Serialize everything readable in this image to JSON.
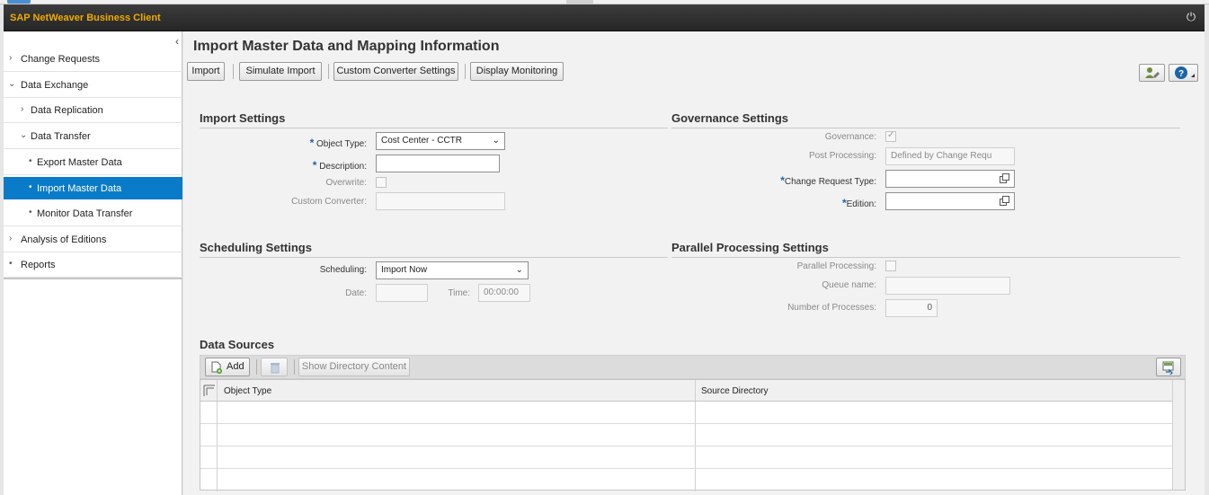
{
  "shell": {
    "title": "SAP NetWeaver Business Client"
  },
  "nav": {
    "items": [
      {
        "label": "Change Requests",
        "arrow": "›"
      },
      {
        "label": "Data Exchange",
        "arrow": "⌄"
      },
      {
        "label": "Data Replication",
        "arrow": "›"
      },
      {
        "label": "Data Transfer",
        "arrow": "⌄"
      },
      {
        "label": "Export Master Data",
        "arrow": "•"
      },
      {
        "label": "Import Master Data",
        "arrow": "•"
      },
      {
        "label": "Monitor Data Transfer",
        "arrow": "•"
      },
      {
        "label": "Analysis of Editions",
        "arrow": "›"
      },
      {
        "label": "Reports",
        "arrow": "•"
      }
    ]
  },
  "page": {
    "title": "Import Master Data and Mapping Information"
  },
  "toolbar": {
    "import": "Import",
    "simulate_import": "Simulate Import",
    "custom_converter_settings": "Custom Converter Settings",
    "display_monitoring": "Display Monitoring"
  },
  "import_settings": {
    "title": "Import Settings",
    "object_type_label": "Object Type:",
    "object_type_value": "Cost Center - CCTR",
    "description_label": "Description:",
    "description_value": "",
    "overwrite_label": "Overwrite:",
    "custom_converter_label": "Custom Converter:",
    "custom_converter_value": ""
  },
  "governance_settings": {
    "title": "Governance Settings",
    "governance_label": "Governance:",
    "governance_checked": true,
    "post_processing_label": "Post Processing:",
    "post_processing_value": "Defined by Change Requ",
    "change_request_type_label": "Change Request Type:",
    "change_request_type_value": "",
    "edition_label": "Edition:",
    "edition_value": ""
  },
  "scheduling_settings": {
    "title": "Scheduling Settings",
    "scheduling_label": "Scheduling:",
    "scheduling_value": "Import Now",
    "date_label": "Date:",
    "date_value": "",
    "time_label": "Time:",
    "time_value": "00:00:00"
  },
  "parallel_processing_settings": {
    "title": "Parallel Processing Settings",
    "parallel_processing_label": "Parallel Processing:",
    "queue_name_label": "Queue name:",
    "queue_name_value": "",
    "number_of_processes_label": "Number of Processes:",
    "number_of_processes_value": "0"
  },
  "data_sources": {
    "title": "Data Sources",
    "add_label": "Add",
    "show_directory_content_label": "Show Directory Content",
    "columns": [
      "Object Type",
      "Source Directory"
    ],
    "rows": [
      [
        "",
        ""
      ],
      [
        "",
        ""
      ],
      [
        "",
        ""
      ],
      [
        "",
        ""
      ]
    ]
  },
  "colors": {
    "shell_title": "#f0ab00",
    "nav_selected": "#0a7bc8",
    "required_marker": "#1c63a8"
  }
}
